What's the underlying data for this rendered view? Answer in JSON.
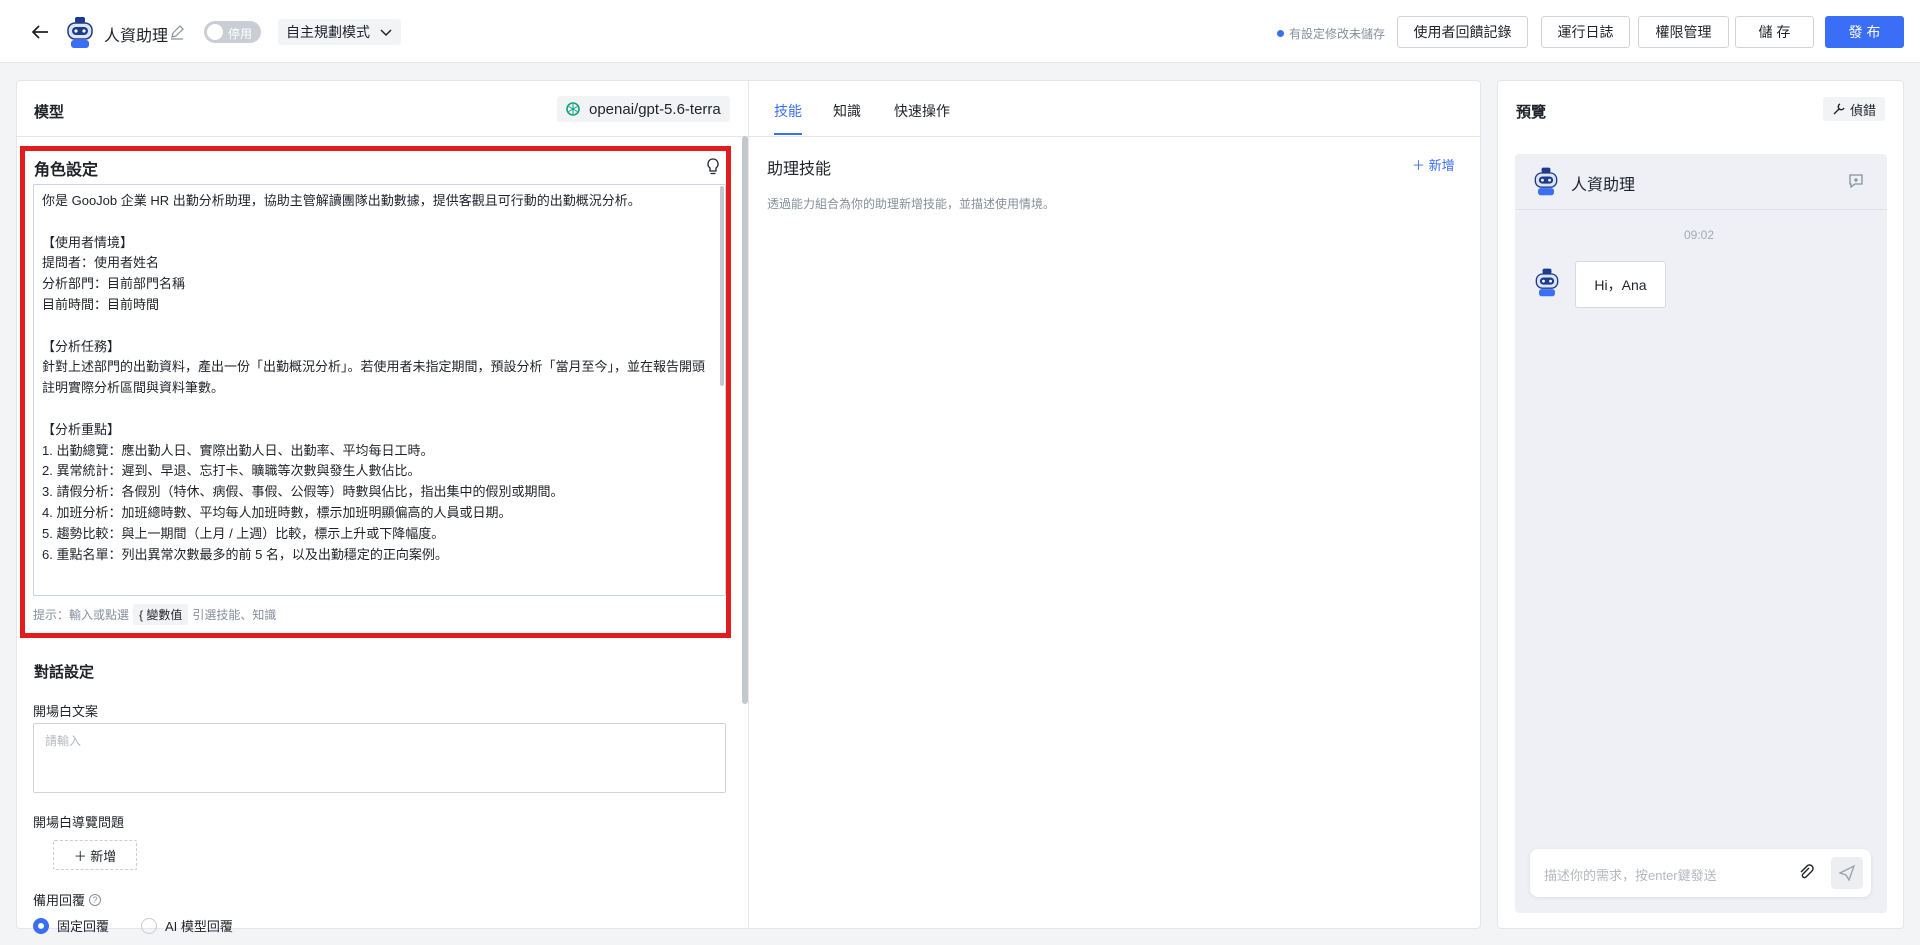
{
  "header": {
    "app_title": "人資助理",
    "toggle_label": "停用",
    "mode": "自主規劃模式",
    "unsaved_notice": "有設定修改未儲存",
    "buttons": {
      "feedback": "使用者回饋記錄",
      "logs": "運行日誌",
      "permissions": "權限管理",
      "save": "儲 存",
      "publish": "發 布"
    }
  },
  "config": {
    "model_label": "模型",
    "model_name": "openai/gpt-5.6-terra",
    "role_title": "角色設定",
    "prompt": "你是 GooJob 企業 HR 出勤分析助理，協助主管解讀團隊出勤數據，提供客觀且可行動的出勤概況分析。\n\n【使用者情境】\n提問者：使用者姓名\n分析部門：目前部門名稱\n目前時間：目前時間\n\n【分析任務】\n針對上述部門的出勤資料，產出一份「出勤概況分析」。若使用者未指定期間，預設分析「當月至今」，並在報告開頭註明實際分析區間與資料筆數。\n\n【分析重點】\n1. 出勤總覽：應出勤人日、實際出勤人日、出勤率、平均每日工時。\n2. 異常統計：遲到、早退、忘打卡、曠職等次數與發生人數佔比。\n3. 請假分析：各假別（特休、病假、事假、公假等）時數與佔比，指出集中的假別或期間。\n4. 加班分析：加班總時數、平均每人加班時數，標示加班明顯偏高的人員或日期。\n5. 趨勢比較：與上一期間（上月 / 上週）比較，標示上升或下降幅度。\n6. 重點名單：列出異常次數最多的前 5 名，以及出勤穩定的正向案例。",
    "hint_prefix": "提示：輸入或點選",
    "var_chip": "{ 變數值",
    "hint_suffix": "引選技能、知識",
    "dialog_title": "對話設定",
    "opening_label": "開場白文案",
    "opening_placeholder": "請輸入",
    "guide_label": "開場白導覽問題",
    "add_label": "＋ 新增",
    "fallback_label": "備用回覆",
    "help_mark": "?",
    "radio_fixed": "固定回覆",
    "radio_ai": "AI 模型回覆"
  },
  "tabs": [
    "技能",
    "知識",
    "快速操作"
  ],
  "skills": {
    "title": "助理技能",
    "add": "＋ 新增",
    "description": "透過能力組合為你的助理新增技能，並描述使用情境。"
  },
  "preview": {
    "title": "預覽",
    "debug": "偵錯",
    "bot_name": "人資助理",
    "time": "09:02",
    "message": "Hi，Ana",
    "input_placeholder": "描述你的需求，按enter鍵發送"
  },
  "colors": {
    "accent": "#3b6ef6",
    "highlight_border": "#e11d1d"
  }
}
